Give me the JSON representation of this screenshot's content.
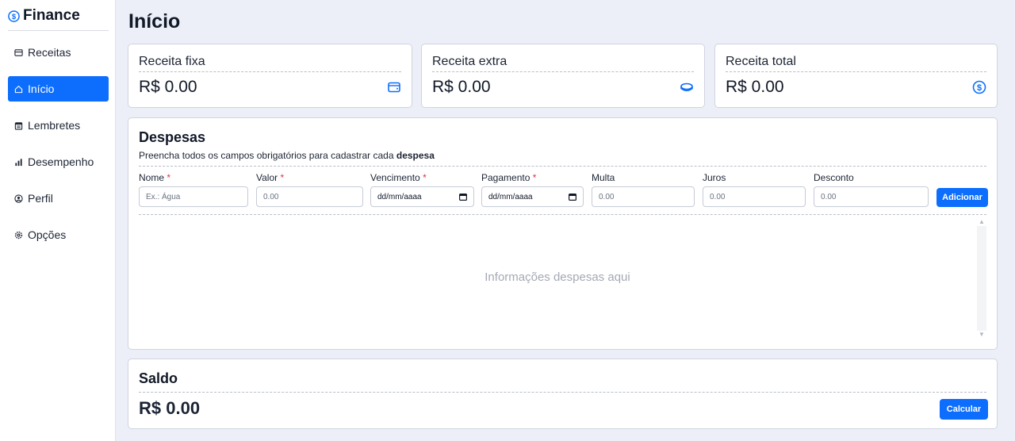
{
  "app": {
    "name": "Finance"
  },
  "sidebar": {
    "items": [
      {
        "label": "Receitas",
        "icon": "wallet-icon"
      },
      {
        "label": "Início",
        "icon": "home-icon",
        "active": true
      },
      {
        "label": "Lembretes",
        "icon": "calendar-icon"
      },
      {
        "label": "Desempenho",
        "icon": "bar-chart-icon"
      },
      {
        "label": "Perfil",
        "icon": "user-icon"
      },
      {
        "label": "Opções",
        "icon": "gear-icon"
      }
    ]
  },
  "page": {
    "title": "Início"
  },
  "summary": [
    {
      "label": "Receita fixa",
      "value": "R$ 0.00",
      "icon": "wallet-icon"
    },
    {
      "label": "Receita extra",
      "value": "R$ 0.00",
      "icon": "coins-icon"
    },
    {
      "label": "Receita total",
      "value": "R$ 0.00",
      "icon": "dollar-circle-icon"
    }
  ],
  "despesas": {
    "title": "Despesas",
    "subtitle_prefix": "Preencha todos os campos obrigatórios para cadastrar cada ",
    "subtitle_bold": "despesa",
    "required_mark": "*",
    "fields": [
      {
        "label": "Nome",
        "required": true,
        "placeholder": "Ex.: Água"
      },
      {
        "label": "Valor",
        "required": true,
        "placeholder": "0.00"
      },
      {
        "label": "Vencimento",
        "required": true,
        "value": "dd/mm/aaaa"
      },
      {
        "label": "Pagamento",
        "required": true,
        "value": "dd/mm/aaaa"
      },
      {
        "label": "Multa",
        "required": false,
        "placeholder": "0.00"
      },
      {
        "label": "Juros",
        "required": false,
        "placeholder": "0.00"
      },
      {
        "label": "Desconto",
        "required": false,
        "placeholder": "0.00"
      }
    ],
    "add_label": "Adicionar",
    "empty_text": "Informações despesas aqui"
  },
  "saldo": {
    "title": "Saldo",
    "value": "R$ 0.00",
    "button_label": "Calcular"
  },
  "colors": {
    "accent": "#0d6efd",
    "background": "#eceff7",
    "required": "#dc3545"
  }
}
